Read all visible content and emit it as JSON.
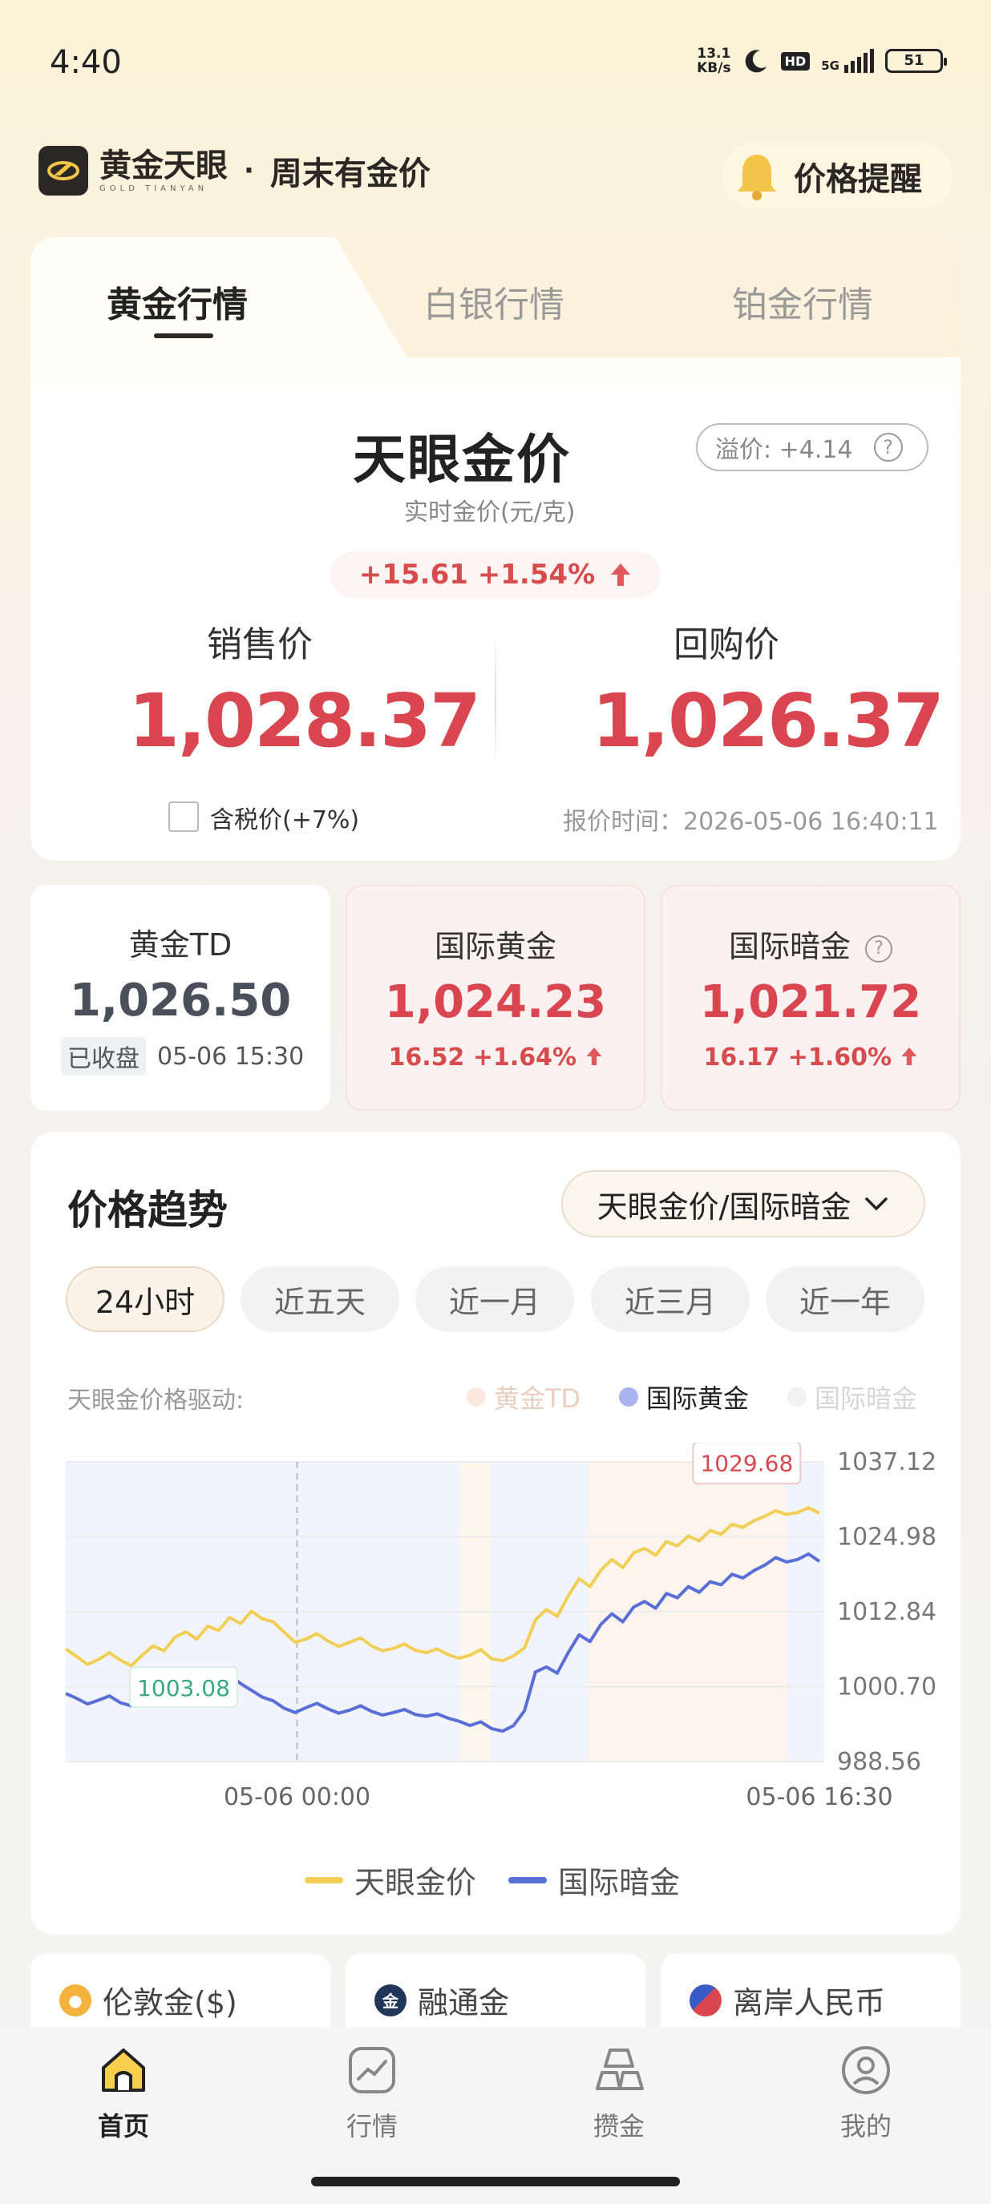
{
  "status_bar": {
    "time": "4:40",
    "net_speed_value": "13.1",
    "net_speed_unit": "KB/s",
    "hd": "HD",
    "signal": "5G",
    "battery": "51"
  },
  "header": {
    "logo_name": "黄金天眼",
    "logo_sub": "GOLD TIANYAN",
    "dot": "·",
    "slogan": "周末有金价",
    "alert_label": "价格提醒"
  },
  "tabs": [
    {
      "label": "黄金行情",
      "active": true
    },
    {
      "label": "白银行情",
      "active": false
    },
    {
      "label": "铂金行情",
      "active": false
    }
  ],
  "price_card": {
    "title": "天眼金价",
    "subtitle": "实时金价(元/克)",
    "premium_label": "溢价: +4.14",
    "premium_help": "?",
    "change": "+15.61 +1.54%",
    "sell_label": "销售价",
    "sell_price": "1,028.37",
    "buy_label": "回购价",
    "buy_price": "1,026.37",
    "tax_label": "含税价(+7%)",
    "quote_time": "报价时间：2026-05-06 16:40:11"
  },
  "mini_cards": {
    "td": {
      "title": "黄金TD",
      "value": "1,026.50",
      "status": "已收盘",
      "time": "05-06 15:30"
    },
    "intl": {
      "title": "国际黄金",
      "value": "1,024.23",
      "change": "16.52 +1.64%"
    },
    "dark": {
      "title": "国际暗金",
      "value": "1,021.72",
      "change": "16.17 +1.60%",
      "help": "?"
    }
  },
  "trend": {
    "title": "价格趋势",
    "dropdown": "天眼金价/国际暗金",
    "ranges": [
      "24小时",
      "近五天",
      "近一月",
      "近三月",
      "近一年"
    ],
    "active_range": 0,
    "drive_label": "天眼金价格驱动:",
    "drivers": [
      {
        "label": "黄金TD",
        "color": "#f6d9c8",
        "active": false
      },
      {
        "label": "国际黄金",
        "color": "#a9b3f0",
        "active": true
      },
      {
        "label": "国际暗金",
        "color": "#ececec",
        "active": false
      }
    ],
    "max_label": "1029.68",
    "min_label": "1003.08",
    "bottom_legend": [
      {
        "label": "天眼金价",
        "color": "#f1cf57"
      },
      {
        "label": "国际暗金",
        "color": "#5a6fd6"
      }
    ]
  },
  "chart_data": {
    "type": "line",
    "x_ticks": [
      "05-06 00:00",
      "05-06 16:30"
    ],
    "y_ticks": [
      1037.12,
      1024.98,
      1012.84,
      1000.7,
      988.56
    ],
    "ylim": [
      988.56,
      1037.12
    ],
    "series": [
      {
        "name": "天眼金价",
        "color": "#f1cf57",
        "values": [
          1006.8,
          1005.6,
          1004.3,
          1005.1,
          1006.2,
          1005.0,
          1004.1,
          1005.8,
          1007.3,
          1006.5,
          1008.7,
          1009.6,
          1008.4,
          1010.5,
          1009.8,
          1011.9,
          1010.9,
          1012.9,
          1011.7,
          1011.2,
          1009.5,
          1007.9,
          1008.4,
          1009.3,
          1008.1,
          1007.2,
          1007.9,
          1008.6,
          1007.3,
          1006.5,
          1006.9,
          1007.6,
          1006.6,
          1006.2,
          1006.8,
          1005.9,
          1005.3,
          1005.8,
          1006.7,
          1005.2,
          1004.9,
          1005.7,
          1007.0,
          1011.5,
          1013.2,
          1012.1,
          1015.4,
          1018.2,
          1016.9,
          1019.6,
          1021.3,
          1020.0,
          1022.4,
          1023.1,
          1022.0,
          1024.2,
          1023.5,
          1025.1,
          1024.3,
          1026.0,
          1025.4,
          1027.0,
          1026.5,
          1027.6,
          1028.3,
          1029.2,
          1028.6,
          1028.9,
          1029.68,
          1028.8
        ]
      },
      {
        "name": "国际暗金",
        "color": "#5a6fd6",
        "values": [
          999.6,
          998.8,
          997.9,
          998.5,
          999.2,
          998.1,
          997.6,
          998.9,
          1000.3,
          999.5,
          1001.6,
          1002.2,
          1001.1,
          1002.8,
          1001.7,
          1002.6,
          1001.2,
          1000.1,
          999.0,
          998.4,
          997.2,
          996.5,
          997.3,
          998.0,
          997.1,
          996.4,
          996.9,
          997.6,
          996.7,
          996.1,
          996.5,
          997.0,
          996.2,
          995.9,
          996.3,
          995.6,
          995.1,
          994.4,
          995.0,
          993.9,
          993.5,
          994.4,
          996.8,
          1003.08,
          1003.9,
          1002.9,
          1006.2,
          1009.1,
          1008.0,
          1010.8,
          1012.5,
          1011.2,
          1013.6,
          1014.5,
          1013.4,
          1015.8,
          1015.1,
          1016.9,
          1016.0,
          1017.7,
          1017.2,
          1018.9,
          1018.3,
          1019.5,
          1020.4,
          1021.6,
          1020.9,
          1021.3,
          1022.2,
          1021.0
        ]
      }
    ]
  },
  "market_cards": [
    {
      "label": "伦敦金($)",
      "icon": "london-gold-icon"
    },
    {
      "label": "融通金",
      "icon": "rongtong-icon"
    },
    {
      "label": "离岸人民币",
      "icon": "usd-flag-icon"
    }
  ],
  "bottom_nav": [
    {
      "label": "首页",
      "icon": "home-icon",
      "active": true
    },
    {
      "label": "行情",
      "icon": "chart-trend-icon",
      "active": false
    },
    {
      "label": "攒金",
      "icon": "gold-bars-icon",
      "active": false
    },
    {
      "label": "我的",
      "icon": "profile-icon",
      "active": false
    }
  ]
}
